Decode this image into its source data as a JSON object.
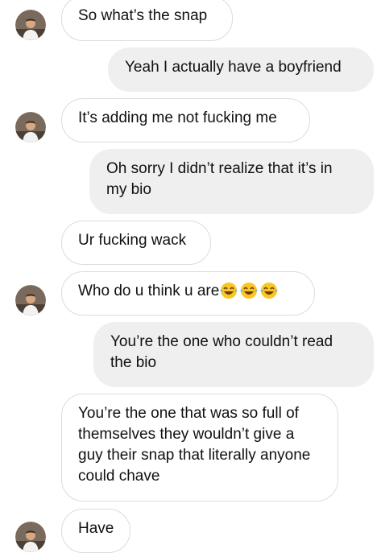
{
  "conversation": {
    "messages": [
      {
        "sender": "them",
        "text": "So what’s the snap"
      },
      {
        "sender": "me",
        "text": "Yeah I actually have a boyfriend"
      },
      {
        "sender": "them",
        "text": "It’s adding me not fucking me"
      },
      {
        "sender": "me",
        "text": "Oh sorry I didn’t realize that it’s in my bio"
      },
      {
        "sender": "them",
        "text": "Ur fucking wack"
      },
      {
        "sender": "them",
        "text": "Who do u think u are",
        "emoji": "😂😂😂"
      },
      {
        "sender": "me",
        "text": "You’re the one who couldn’t read the bio"
      },
      {
        "sender": "them",
        "text": "You’re the one that was so full of themselves they wouldn’t give a guy their snap that literally anyone could chave"
      },
      {
        "sender": "them",
        "text": "Have"
      }
    ]
  },
  "icons": {
    "avatar": "profile-photo-avatar",
    "emoji": "face-with-tears-of-joy-emoji"
  },
  "colors": {
    "incoming_bubble": "#ffffff",
    "incoming_border": "#dcdcdc",
    "outgoing_bubble": "#efefef",
    "text": "#111111"
  }
}
